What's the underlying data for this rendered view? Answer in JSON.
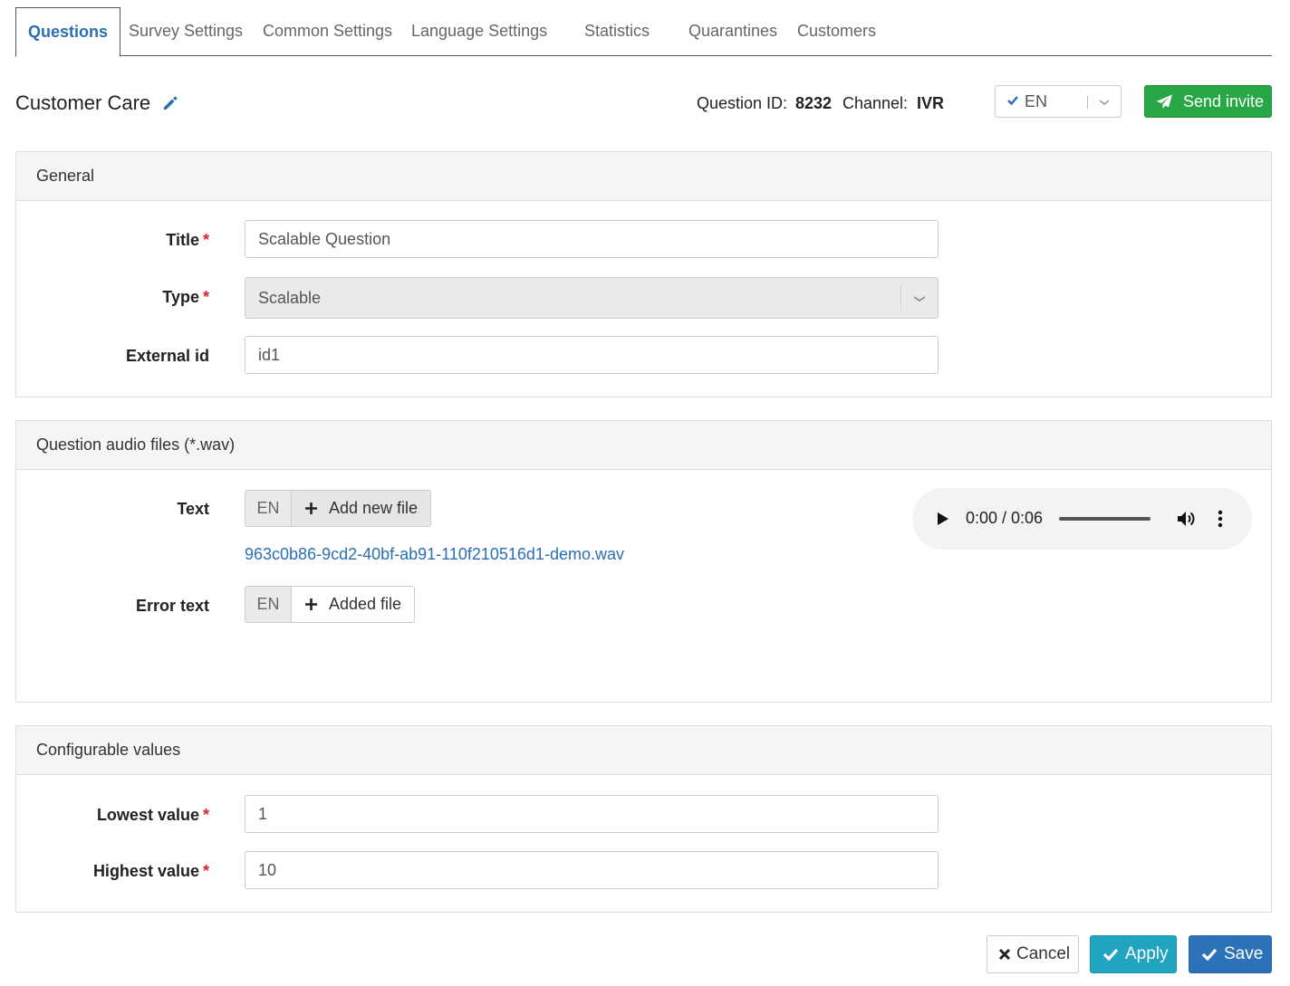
{
  "tabs": [
    {
      "label": "Questions",
      "active": true
    },
    {
      "label": "Survey Settings"
    },
    {
      "label": "Common Settings"
    },
    {
      "label": "Language Settings"
    },
    {
      "label": "Statistics"
    },
    {
      "label": "Quarantines"
    },
    {
      "label": "Customers"
    }
  ],
  "header": {
    "title": "Customer Care",
    "question_id_label": "Question ID:",
    "question_id": "8232",
    "channel_label": "Channel:",
    "channel": "IVR",
    "language": "EN",
    "send_invite_label": "Send invite"
  },
  "general": {
    "heading": "General",
    "title_label": "Title",
    "title_value": "Scalable Question",
    "type_label": "Type",
    "type_value": "Scalable",
    "external_id_label": "External id",
    "external_id_value": "id1",
    "required_mark": "*"
  },
  "audio_files": {
    "heading": "Question audio files (*.wav)",
    "text_label": "Text",
    "text_lang": "EN",
    "text_add_label": "Add new file",
    "text_file_name": "963c0b86-9cd2-40bf-ab91-110f210516d1-demo.wav",
    "error_text_label": "Error text",
    "error_text_lang": "EN",
    "error_text_add_label": "Added file",
    "player_time": "0:00 / 0:06"
  },
  "configurable": {
    "heading": "Configurable values",
    "lowest_label": "Lowest value",
    "lowest_value": "1",
    "highest_label": "Highest value",
    "highest_value": "10"
  },
  "footer": {
    "cancel_label": "Cancel",
    "apply_label": "Apply",
    "save_label": "Save"
  },
  "colors": {
    "link": "#2a6fb4",
    "success": "#27a745",
    "info": "#20a4bf",
    "primary": "#2b72b8",
    "required": "#d9262b"
  }
}
